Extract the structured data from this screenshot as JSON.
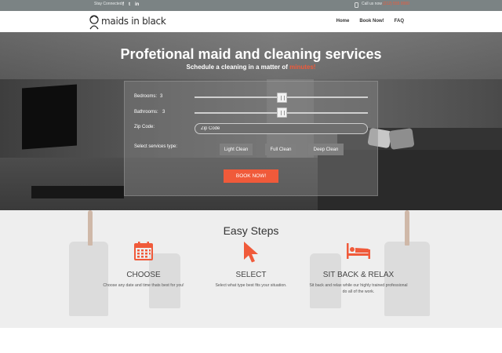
{
  "topbar": {
    "stay_connected": "Stay Connected",
    "social": [
      "f",
      "t",
      "in"
    ],
    "call_label": "Call us now",
    "phone": "(212) 555 0000"
  },
  "header": {
    "logo": "maids in black",
    "nav": [
      "Home",
      "Book Now!",
      "FAQ"
    ]
  },
  "hero": {
    "title": "Profetional maid and cleaning services",
    "subtitle_prefix": "Schedule a cleaning in a matter of",
    "subtitle_highlight": "minutes!",
    "form": {
      "bedrooms_label": "Bedrooms:",
      "bedrooms_value": "3",
      "bathrooms_label": "Bathrooms:",
      "bathrooms_value": "3",
      "zip_label": "Zip Code:",
      "zip_placeholder": "Zip Code",
      "services_label": "Select services type:",
      "services": [
        "Light Clean",
        "Full Clean",
        "Deep Clean"
      ],
      "book_button": "BOOK NOW!"
    }
  },
  "easy_steps": {
    "title": "Easy Steps",
    "steps": [
      {
        "heading": "CHOOSE",
        "text": "Choose any date and time thats best for you!",
        "icon": "calendar-icon"
      },
      {
        "heading": "SELECT",
        "text": "Select what type best fits your situation.",
        "icon": "cursor-icon"
      },
      {
        "heading": "SIT BACK & RELAX",
        "text": "Sit back and relax while our highly trained professional do all of the work.",
        "icon": "bed-icon"
      }
    ]
  },
  "colors": {
    "accent": "#f05a3a",
    "topbar": "#7b8384"
  }
}
